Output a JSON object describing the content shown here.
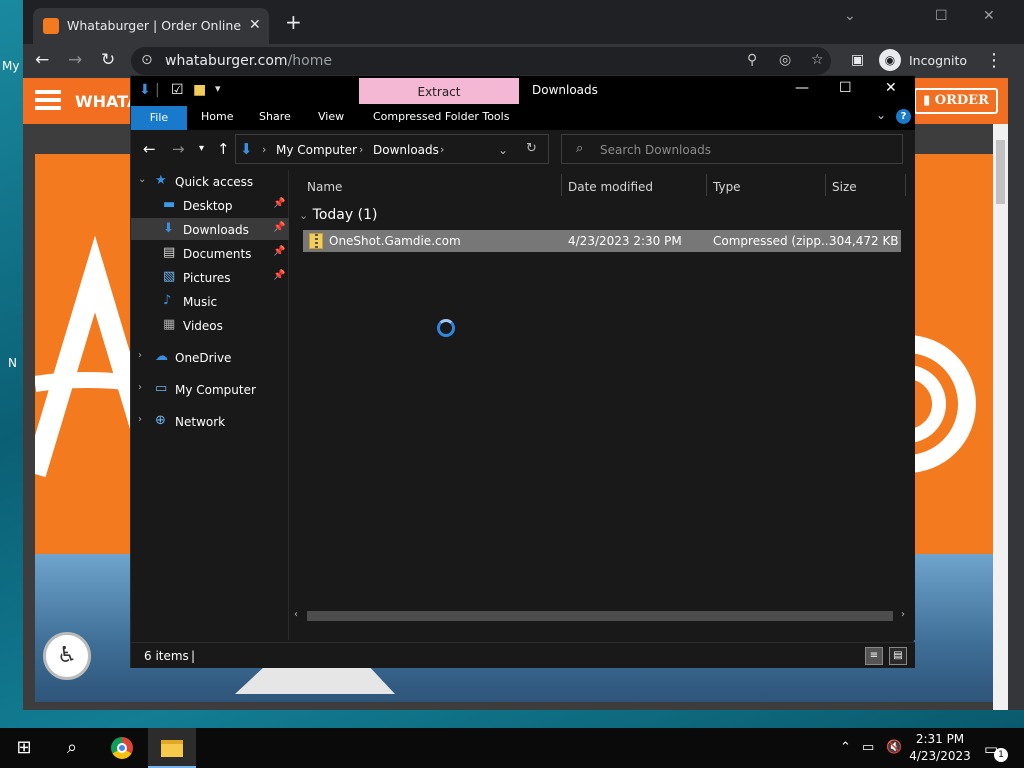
{
  "desktop": {
    "labels": [
      "My",
      "N"
    ]
  },
  "browser": {
    "tab_title": "Whataburger | Order Online with",
    "tab_close": "✕",
    "new_tab": "+",
    "url_host": "whataburger.com",
    "url_path": "/home",
    "incognito_label": "Incognito",
    "site": {
      "brand": "WHATAB",
      "order_label": "ORDER"
    }
  },
  "explorer": {
    "contextual_tab": "Extract",
    "title": "Downloads",
    "ribbon_tabs": {
      "file": "File",
      "home": "Home",
      "share": "Share",
      "view": "View",
      "tools": "Compressed Folder Tools"
    },
    "breadcrumb": [
      "My Computer",
      "Downloads"
    ],
    "search_placeholder": "Search Downloads",
    "nav_items": [
      {
        "label": "Quick access"
      },
      {
        "label": "Desktop"
      },
      {
        "label": "Downloads"
      },
      {
        "label": "Documents"
      },
      {
        "label": "Pictures"
      },
      {
        "label": "Music"
      },
      {
        "label": "Videos"
      },
      {
        "label": "OneDrive"
      },
      {
        "label": "My Computer"
      },
      {
        "label": "Network"
      }
    ],
    "columns": {
      "name": "Name",
      "date": "Date modified",
      "type": "Type",
      "size": "Size"
    },
    "group": "Today (1)",
    "files": [
      {
        "name": "OneShot.Gamdie.com",
        "date": "4/23/2023 2:30 PM",
        "type": "Compressed (zipp...",
        "size": "304,472 KB"
      }
    ],
    "status_count": "6 items"
  },
  "taskbar": {
    "time": "2:31 PM",
    "date": "4/23/2023",
    "notification_count": "1"
  }
}
